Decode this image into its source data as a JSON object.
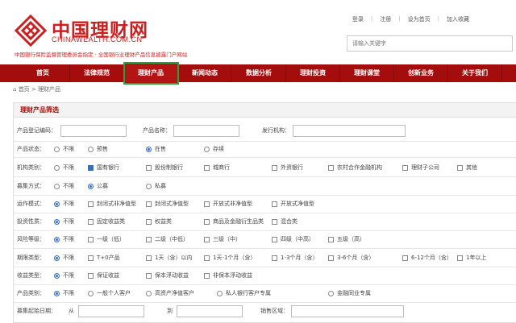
{
  "site": {
    "title": "中国理财网",
    "subtitle": "CHINAWEALTH.COM.CN",
    "tagline": "中国银行保险监督管理委员会指定 · 全国银行业理财产品信息披露门户网站"
  },
  "toplinks": [
    "登录",
    "注册",
    "设为首页",
    "加入收藏"
  ],
  "search": {
    "placeholder": "请输入关键字"
  },
  "nav": [
    "首页",
    "法律规范",
    "理财产品",
    "新闻动态",
    "数据分析",
    "理财投资",
    "理财课堂",
    "创新业务",
    "关于我们"
  ],
  "breadcrumb": {
    "home": "首页",
    "sep": ">",
    "current": "理财产品"
  },
  "filter": {
    "title": "理财产品筛选",
    "code_label": "产品登记编码：",
    "name_label": "产品名称：",
    "issuer_label": "发行机构：",
    "status": {
      "label": "产品状态：",
      "options": [
        "不限",
        "预售",
        "在售",
        "存续"
      ],
      "selected": 2
    },
    "institution": {
      "label": "机构类别：",
      "options": [
        "不限",
        "国有银行",
        "股份制银行",
        "城商行",
        "外资银行",
        "农村合作金融机构",
        "理财子公司",
        "其他"
      ],
      "checked": 1
    },
    "raise": {
      "label": "募集方式：",
      "options": [
        "不限",
        "公募",
        "私募"
      ],
      "selected": 1
    },
    "operation": {
      "label": "运作模式：",
      "options": [
        "不限",
        "封闭式非净值型",
        "封闭式净值型",
        "开放式非净值型",
        "开放式净值型"
      ]
    },
    "invest": {
      "label": "投资性质：",
      "options": [
        "不限",
        "固定收益类",
        "权益类",
        "商品及金融衍生品类",
        "混合类"
      ]
    },
    "risk": {
      "label": "风险等级：",
      "options": [
        "不限",
        "一级（低）",
        "二级（中低）",
        "三级（中）",
        "四级（中高）",
        "五级（高）"
      ]
    },
    "term": {
      "label": "期限类型：",
      "options": [
        "不限",
        "T+0产品",
        "1天（含）以内",
        "1天-1个月（含）",
        "1-3个月（含）",
        "3-6个月（含）",
        "6-12个月（含）",
        "1年以上"
      ]
    },
    "income": {
      "label": "收益类型：",
      "options": [
        "不限",
        "保证收益",
        "保本浮动收益",
        "非保本浮动收益"
      ]
    },
    "customer": {
      "label": "产品类别：",
      "options": [
        "不限",
        "一般个人客户",
        "高资产净值客户",
        "私人银行客户专属",
        "金融同业专属"
      ]
    },
    "date": {
      "label": "募集起始日期：",
      "from": "从",
      "to": "到",
      "region_label": "销售区域："
    }
  }
}
